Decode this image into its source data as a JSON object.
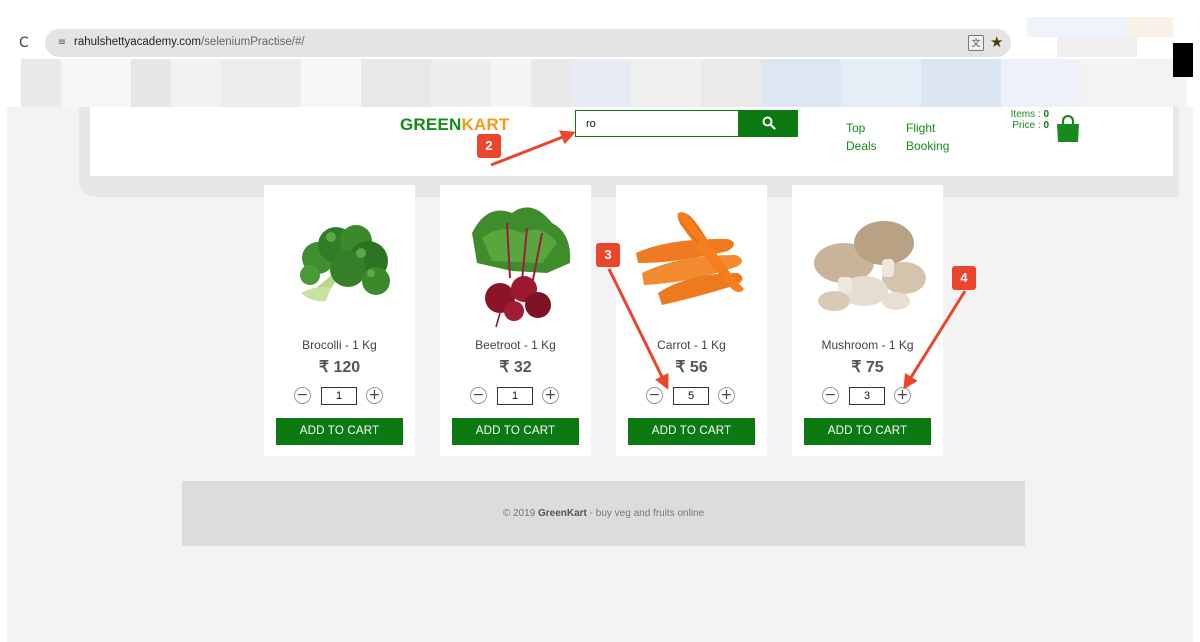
{
  "browser": {
    "url_host": "rahulshettyacademy.com",
    "url_path": "/seleniumPractise/#/",
    "reload_glyph": "C",
    "site_settings_glyph": "≡",
    "translate_glyph": "文",
    "star_glyph": "★"
  },
  "header": {
    "brand_green": "GREEN",
    "brand_orange": "KART",
    "search_value": "ro",
    "nav": {
      "top_deals_line1": "Top",
      "top_deals_line2": "Deals",
      "flight_booking_line1": "Flight",
      "flight_booking_line2": "Booking"
    },
    "items_label": "Items",
    "items_value": "0",
    "price_label": "Price",
    "price_value": "0",
    "colon": ":"
  },
  "products": [
    {
      "name": "Brocolli - 1 Kg",
      "price": "₹ 120",
      "qty": "1",
      "add_label": "ADD TO CART",
      "minus": "−",
      "plus": "+"
    },
    {
      "name": "Beetroot - 1 Kg",
      "price": "₹ 32",
      "qty": "1",
      "add_label": "ADD TO CART",
      "minus": "−",
      "plus": "+"
    },
    {
      "name": "Carrot - 1 Kg",
      "price": "₹ 56",
      "qty": "5",
      "add_label": "ADD TO CART",
      "minus": "−",
      "plus": "+"
    },
    {
      "name": "Mushroom - 1 Kg",
      "price": "₹ 75",
      "qty": "3",
      "add_label": "ADD TO CART",
      "minus": "−",
      "plus": "+"
    }
  ],
  "footer": {
    "prefix": "© 2019 ",
    "brand": "GreenKart",
    "suffix": " - buy veg and fruits online"
  },
  "annotations": [
    "2",
    "3",
    "4"
  ],
  "colors": {
    "brand_green": "#168b1b",
    "brand_orange": "#f39c12",
    "button_green": "#0b7a13",
    "annotation_red": "#e9462b"
  },
  "icons": {
    "search": "search-icon",
    "cart": "shopping-bag-icon"
  }
}
